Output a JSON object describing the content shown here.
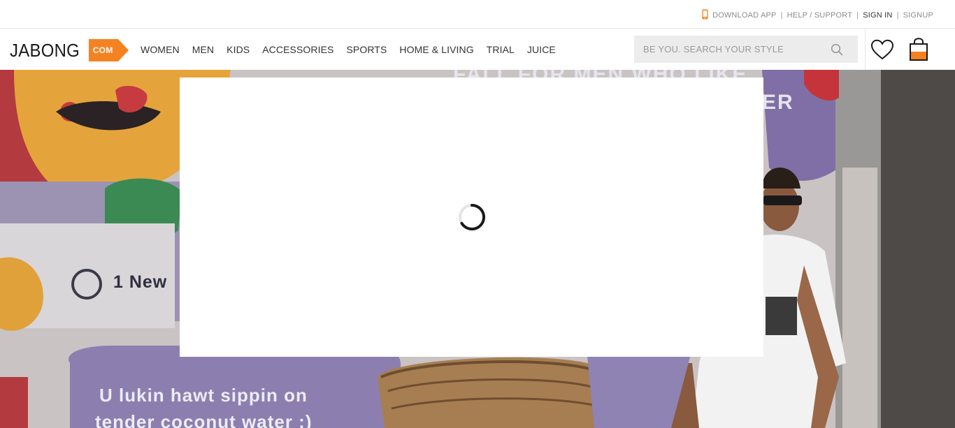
{
  "topbar": {
    "download_app": "DOWNLOAD APP",
    "sep1": "|",
    "help_support": "HELP / SUPPORT",
    "sep2": "|",
    "sign_in": "SIGN IN",
    "sep3": "|",
    "signup": "SIGNUP"
  },
  "header": {
    "logo_text": "JABONG",
    "logo_badge": "COM",
    "nav": [
      {
        "label": "WOMEN"
      },
      {
        "label": "MEN"
      },
      {
        "label": "KIDS"
      },
      {
        "label": "ACCESSORIES"
      },
      {
        "label": "SPORTS"
      },
      {
        "label": "HOME & LIVING"
      },
      {
        "label": "TRIAL"
      },
      {
        "label": "JUICE"
      }
    ],
    "search": {
      "placeholder": "BE YOU. SEARCH YOUR STYLE",
      "value": ""
    },
    "icons": {
      "search": "search-icon",
      "wishlist": "heart-icon",
      "bag": "shopping-bag-icon",
      "phone": "phone-icon"
    }
  },
  "hero": {
    "wall_text_1": "1 New",
    "wall_text_2": "U lukin hawt sippin on",
    "wall_text_3": "tender coconut water :)",
    "wall_text_top": "FALL FOR MEN WHO LIKE",
    "wall_text_top_2": "ER"
  },
  "modal": {
    "state": "loading"
  },
  "colors": {
    "brand_orange": "#f58220",
    "text_dark": "#333333",
    "search_bg": "#ececec"
  }
}
